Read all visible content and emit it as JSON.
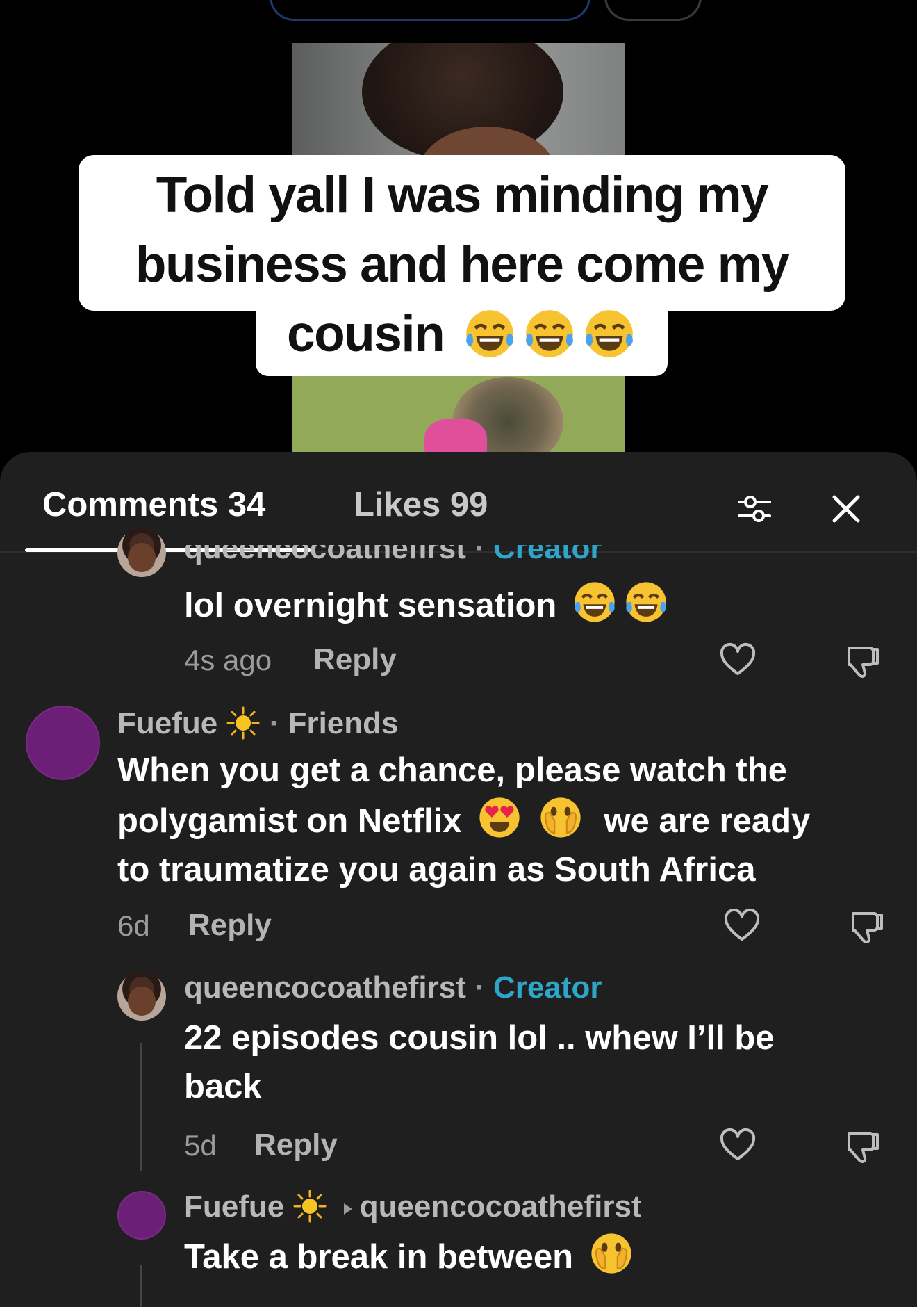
{
  "video": {
    "caption_line1": "Told yall I was minding my",
    "caption_line2": "business and here come my",
    "caption_line3": "cousin",
    "caption_emoji": [
      "face-with-tears-of-joy",
      "face-with-tears-of-joy",
      "face-with-tears-of-joy"
    ]
  },
  "tabs": {
    "comments": "Comments 34",
    "likes": "Likes 99"
  },
  "icons": {
    "filter": "sliders-icon",
    "close": "close-icon",
    "heart": "heart-outline-icon",
    "dislike": "thumbs-down-icon",
    "sun": "sun-emoji"
  },
  "colors": {
    "sheet_bg": "#1f1f1f",
    "creator": "#2fa6c9",
    "avatar_purple": "#6b1f77"
  },
  "comments": [
    {
      "author": "queencocoathefirst",
      "tag": "Creator",
      "text": "lol overnight sensation",
      "emoji": [
        "face-with-tears-of-joy",
        "face-with-tears-of-joy"
      ],
      "time": "4s ago",
      "reply": "Reply"
    },
    {
      "author": "Fuefue",
      "tag": "Friends",
      "text_line1": "When you get a chance, please watch the",
      "text_line2a": "polygamist on Netflix",
      "text_line2b": "we are ready",
      "text_line3": "to traumatize you again as South Africa",
      "emoji": [
        "smiling-face-with-heart-eyes",
        "face-with-open-eyes-and-hand-over-mouth"
      ],
      "time": "6d",
      "reply": "Reply"
    },
    {
      "author": "queencocoathefirst",
      "tag": "Creator",
      "text_line1": "22 episodes cousin lol .. whew I’ll be",
      "text_line2": "back",
      "time": "5d",
      "reply": "Reply"
    },
    {
      "author": "Fuefue",
      "reply_to": "queencocoathefirst",
      "text": "Take a break in between",
      "emoji": [
        "face-with-open-eyes-and-hand-over-mouth"
      ]
    }
  ]
}
